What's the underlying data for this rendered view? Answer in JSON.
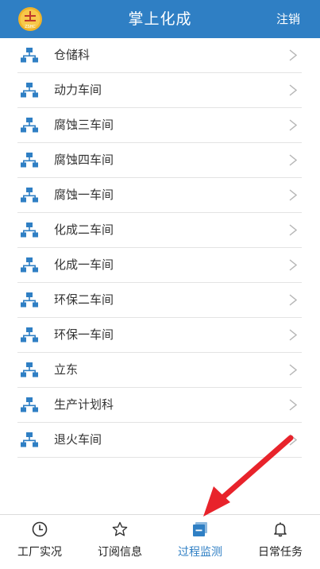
{
  "header": {
    "title": "掌上化成",
    "logout": "注销",
    "logo_text": "ZSHC"
  },
  "list": {
    "items": [
      {
        "label": "仓储科"
      },
      {
        "label": "动力车间"
      },
      {
        "label": "腐蚀三车间"
      },
      {
        "label": "腐蚀四车间"
      },
      {
        "label": "腐蚀一车间"
      },
      {
        "label": "化成二车间"
      },
      {
        "label": "化成一车间"
      },
      {
        "label": "环保二车间"
      },
      {
        "label": "环保一车间"
      },
      {
        "label": "立东"
      },
      {
        "label": "生产计划科"
      },
      {
        "label": "退火车间"
      }
    ]
  },
  "tabbar": {
    "tabs": [
      {
        "label": "工厂实况",
        "icon": "clock-icon"
      },
      {
        "label": "订阅信息",
        "icon": "star-icon"
      },
      {
        "label": "过程监测",
        "icon": "monitor-icon",
        "active": true
      },
      {
        "label": "日常任务",
        "icon": "bell-icon"
      }
    ]
  },
  "colors": {
    "accent": "#2f7fc4",
    "annotation_arrow": "#e8232b"
  }
}
